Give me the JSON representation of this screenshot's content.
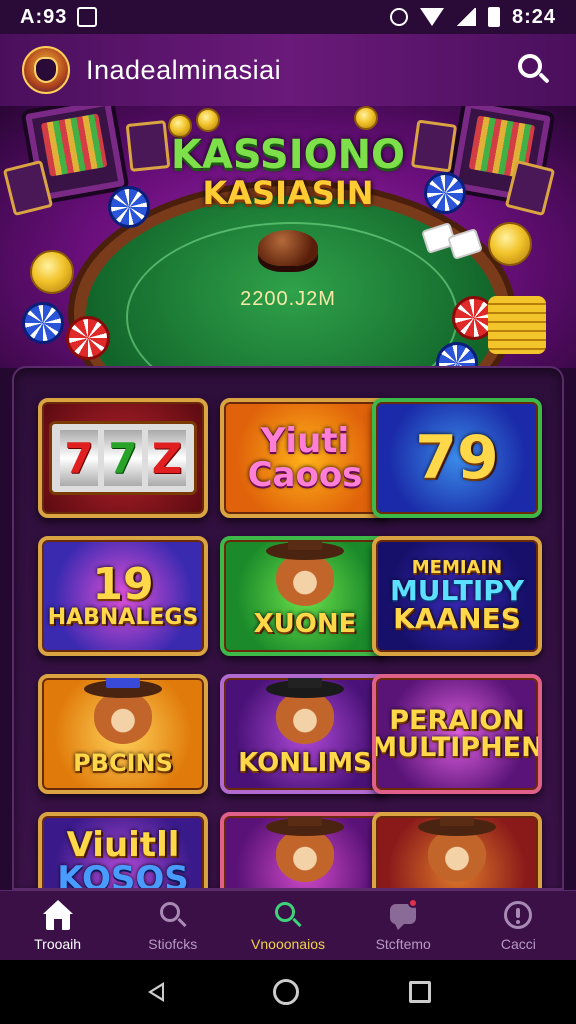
{
  "status_bar": {
    "time_left": "A:93",
    "time_right": "8:24"
  },
  "app_bar": {
    "title": "Inadealminasiai"
  },
  "hero": {
    "title_line1": "KASSIONO",
    "title_line2": "KASIASIN",
    "amount": "2200.J2M"
  },
  "games": [
    {
      "label": "",
      "reels": [
        "7",
        "7",
        "Z"
      ]
    },
    {
      "label_line1": "Yiuti",
      "label_line2": "Caoos"
    },
    {
      "label": "79"
    },
    {
      "label_line1": "19",
      "label_line2": "HABNALEGS"
    },
    {
      "label": "XUONE"
    },
    {
      "label_line1": "MEMIAIN",
      "label_line2": "MULTIPY",
      "label_line3": "KAANES"
    },
    {
      "label": "PBCINS"
    },
    {
      "label": "KONLIMS"
    },
    {
      "label_line1": "PERAION",
      "label_line2": "MULTIPHEN"
    },
    {
      "label_line1": "Viuitll",
      "label_line2": "KOSOS"
    },
    {
      "label": ""
    },
    {
      "label": ""
    }
  ],
  "bottom_nav": {
    "items": [
      {
        "label": "Trooaih",
        "icon": "home-icon",
        "state": "active"
      },
      {
        "label": "Stiofcks",
        "icon": "search-icon",
        "state": "normal"
      },
      {
        "label": "Vnooonaios",
        "icon": "search-icon",
        "state": "highlight"
      },
      {
        "label": "Stcftemo",
        "icon": "chat-icon",
        "state": "normal"
      },
      {
        "label": "Cacci",
        "icon": "info-icon",
        "state": "normal"
      }
    ]
  },
  "colors": {
    "background": "#24082f",
    "app_bar": "#6a1a7a",
    "accent_gold": "#d9a441",
    "active_nav": "#f0d24a",
    "felt": "#12652a"
  }
}
